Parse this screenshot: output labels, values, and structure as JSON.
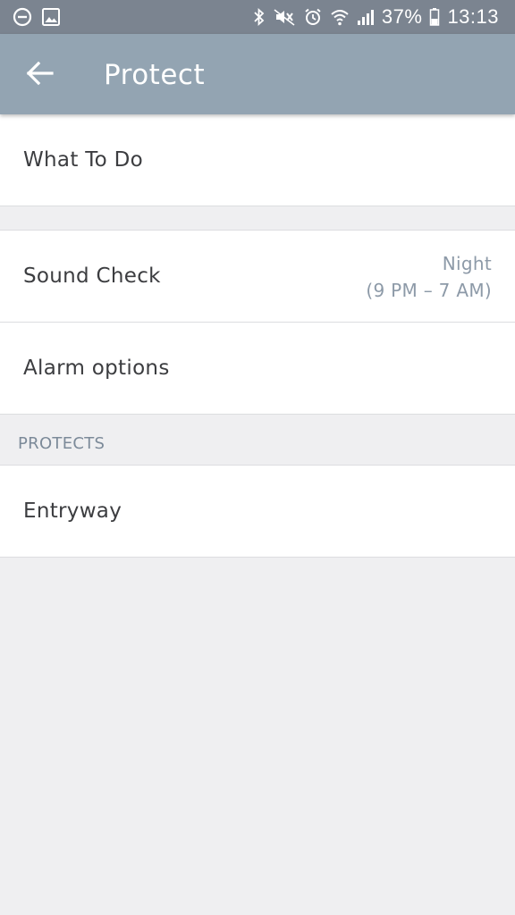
{
  "status_bar": {
    "battery_percent": "37%",
    "time": "13:13",
    "left_icons": [
      "do-not-disturb-icon",
      "gallery-icon"
    ],
    "right_icons": [
      "bluetooth-icon",
      "mute-icon",
      "alarm-icon",
      "wifi-icon",
      "signal-icon",
      "battery-icon"
    ]
  },
  "app_bar": {
    "title": "Protect",
    "back_icon": "arrow-left-icon"
  },
  "rows": {
    "what_to_do": {
      "label": "What To Do"
    },
    "sound_check": {
      "label": "Sound Check",
      "value_line1": "Night",
      "value_line2": "(9 PM – 7 AM)"
    },
    "alarm_options": {
      "label": "Alarm options"
    }
  },
  "protects_section": {
    "header": "PROTECTS",
    "items": [
      {
        "label": "Entryway"
      }
    ]
  },
  "colors": {
    "status_bar": "#7b8490",
    "app_bar": "#93a4b2",
    "background": "#efeff1",
    "value_text": "#8d9aa8"
  }
}
